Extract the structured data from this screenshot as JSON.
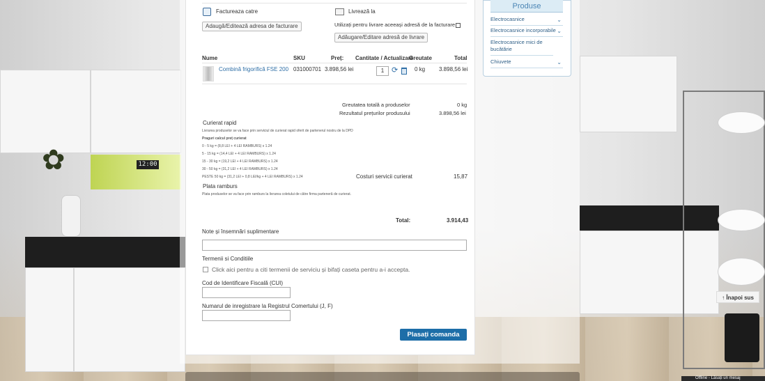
{
  "billing": {
    "title": "Factureaza catre",
    "edit_button": "Adaugă/Editează adresa de facturare"
  },
  "shipping": {
    "title": "Livrează la",
    "same_address_label": "Utilizați pentru livrare aceeași adresă de la facturare",
    "edit_button": "Adăugare/Editare adresă de livrare"
  },
  "table": {
    "headers": [
      "Nume",
      "SKU",
      "Preț:",
      "Cantitate / Actualizare",
      "Greutate",
      "Total"
    ],
    "row": {
      "name": "Combină frigorifică FSE 200",
      "sku": "031000701",
      "price": "3.898,56 lei",
      "qty": "1",
      "weight": "0 kg",
      "total": "3.898,56 lei"
    }
  },
  "totals": {
    "weight_label": "Greutatea totală a produselor",
    "weight_value": "0 kg",
    "subtotal_label": "Rezultatul prețurilor produsului",
    "subtotal_value": "3.898,56 lei",
    "courier_cost_label": "Costuri servicii curierat",
    "courier_cost_value": "15,87",
    "total_label": "Total:",
    "total_value": "3.914,43"
  },
  "courier": {
    "title": "Curierat rapid",
    "desc": "Livrarea produselor se va face prin serviciul de curierat rapid oferit de partenerul nostru de la DPD",
    "prag_title": "Praguri calcul preț curierat",
    "lines": [
      "0 - 5 kg = (8,8 LEI + 4 LEI RAMBURS) x 1.24",
      "5 - 15 kg = (14,4 LEI + 4 LEI RAMBURS) x 1.24",
      "15 - 30 kg = (19,2 LEI + 4 LEI RAMBURS) x 1.24",
      "30 - 50 kg = (31,2 LEI + 4 LEI RAMBURS) x 1.24",
      "PESTE 50 kg = (31,2 LEI + 0,8 LEI/kg + 4 LEI RAMBURS) x 1.24"
    ]
  },
  "cod": {
    "title": "Plata ramburs",
    "desc": "Plata produselor se va face prin ramburs la livrarea coletului de către firma parteneră de curierat."
  },
  "notes": {
    "label": "Note și însemnări suplimentare"
  },
  "terms": {
    "title": "Termenii si Conditiile",
    "checkbox_label": "Click aici pentru a citi termenii de serviciu și bifați caseta pentru a-i accepta."
  },
  "fiscal": {
    "label": "Cod de Identificare Fiscală (CUI)"
  },
  "registry": {
    "label": "Numarul de inregistrare la Registrul Comertului (J, F)"
  },
  "submit_label": "Plasați comanda",
  "sidebar": {
    "title": "Produse",
    "items": [
      "Electrocasnice",
      "Electrocasnice incorporabile",
      "Electrocasnice mici de bucătărie",
      "Chiuvete"
    ]
  },
  "back_to_top": "Înapoi sus",
  "bg_clock": "12:00",
  "offline_label": "Offline - Lăsați un mesaj"
}
